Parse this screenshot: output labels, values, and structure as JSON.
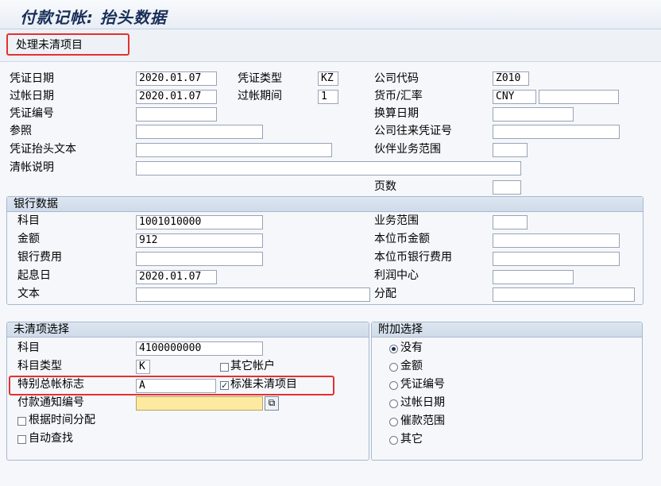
{
  "title": "付款记帐: 抬头数据",
  "toolbar": {
    "process_open_items": "处理未清项目"
  },
  "header": {
    "doc_date_label": "凭证日期",
    "doc_date": "2020.01.07",
    "doc_type_label": "凭证类型",
    "doc_type": "KZ",
    "company_code_label": "公司代码",
    "company_code": "Z010",
    "posting_date_label": "过帐日期",
    "posting_date": "2020.01.07",
    "period_label": "过帐期间",
    "period": "1",
    "currency_label": "货币/汇率",
    "currency": "CNY",
    "rate": "",
    "doc_number_label": "凭证编号",
    "doc_number": "",
    "translation_date_label": "换算日期",
    "translation_date": "",
    "reference_label": "参照",
    "reference": "",
    "intercompany_label": "公司往来凭证号",
    "intercompany": "",
    "header_text_label": "凭证抬头文本",
    "header_text": "",
    "partner_ba_label": "伙伴业务范围",
    "partner_ba": "",
    "clearing_text_label": "清帐说明",
    "clearing_text": "",
    "page_label": "页数",
    "page": ""
  },
  "bank": {
    "title": "银行数据",
    "account_label": "科目",
    "account": "1001010000",
    "business_area_label": "业务范围",
    "business_area": "",
    "amount_label": "金额",
    "amount": "912",
    "local_amount_label": "本位币金额",
    "local_amount": "",
    "bank_charges_label": "银行费用",
    "bank_charges": "",
    "local_bank_charges_label": "本位币银行费用",
    "local_bank_charges": "",
    "value_date_label": "起息日",
    "value_date": "2020.01.07",
    "profit_center_label": "利润中心",
    "profit_center": "",
    "text_label": "文本",
    "text": "",
    "assignment_label": "分配",
    "assignment": ""
  },
  "open_items": {
    "title": "未清项选择",
    "account_label": "科目",
    "account": "4100000000",
    "account_type_label": "科目类型",
    "account_type": "K",
    "other_accounts_label": "其它帐户",
    "special_gl_label": "特别总帐标志",
    "special_gl": "A",
    "standard_oi_label": "标准未清项目",
    "payment_advice_label": "付款通知编号",
    "payment_advice": "",
    "distribute_by_age_label": "根据时间分配",
    "auto_search_label": "自动查找"
  },
  "additional": {
    "title": "附加选择",
    "options": [
      "没有",
      "金额",
      "凭证编号",
      "过帐日期",
      "催款范围",
      "其它"
    ],
    "selected_index": 0
  },
  "colors": {
    "highlight": "#e53030",
    "required_field": "#fdeaa0",
    "title": "#1a2f58"
  }
}
